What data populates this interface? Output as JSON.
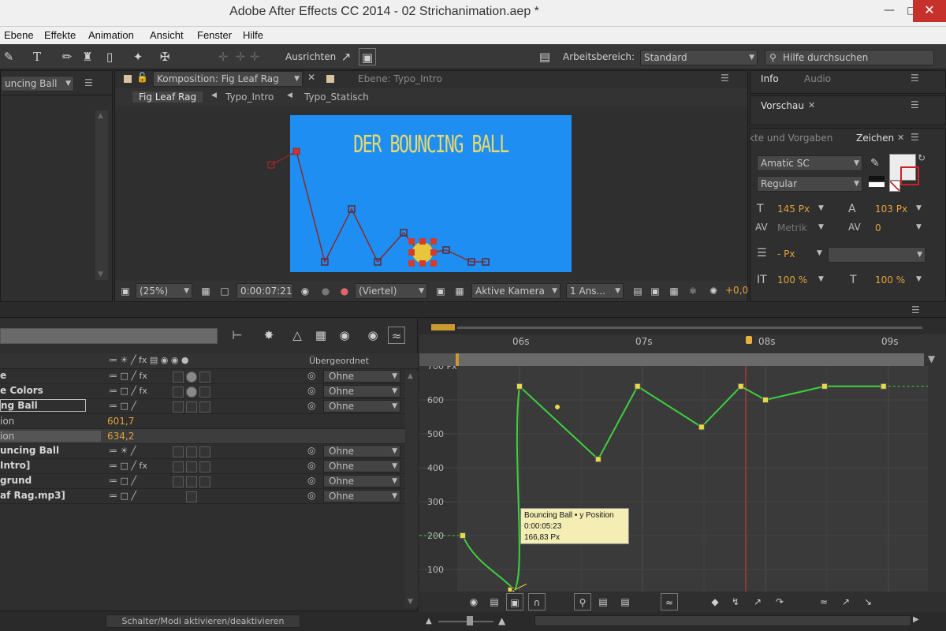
{
  "window": {
    "title": "Adobe After Effects CC 2014 - 02 Strichanimation.aep *"
  },
  "menu": [
    "Ebene",
    "Effekte",
    "Animation",
    "Ansicht",
    "Fenster",
    "Hilfe"
  ],
  "toolbar": {
    "ausrichten_label": "Ausrichten",
    "arbeitsbereich_label": "Arbeitsbereich:",
    "arbeitsbereich_value": "Standard",
    "search_placeholder": "Hilfe durchsuchen"
  },
  "project_panel": {
    "dropdown": "uncing Ball"
  },
  "comp_panel": {
    "tab_label": "Komposition: Fig Leaf Rag",
    "layer_tab": "Ebene: Typo_Intro",
    "breadcrumbs": [
      "Fig Leaf Rag",
      "Typo_Intro",
      "Typo_Statisch"
    ],
    "canvas_text": "DER BOUNCING BALL",
    "zoom": "(25%)",
    "timecode": "0:00:07:21",
    "resolution": "(Viertel)",
    "camera": "Aktive Kamera",
    "views": "1 Ans...",
    "exposure": "+0,0"
  },
  "right_panel": {
    "tabs_top": [
      "Info",
      "Audio"
    ],
    "vorschau": "Vorschau",
    "effects_tab": "kte und Vorgaben",
    "zeichen_tab": "Zeichen",
    "font": "Amatic SC",
    "style": "Regular",
    "size": "145 Px",
    "leading": "103 Px",
    "kerning": "Metrik",
    "tracking": "0",
    "stroke": "- Px",
    "vscale": "100 %",
    "hscale": "100 %",
    "colors": {
      "fill": "#ececec",
      "stroke_none": "#cc2222"
    }
  },
  "timeline": {
    "parent_header": "Übergeordnet",
    "layers": [
      {
        "name": "e",
        "parent": "Ohne"
      },
      {
        "name": "e Colors",
        "parent": "Ohne"
      },
      {
        "name": "ng Ball",
        "parent": "Ohne"
      },
      {
        "name": "ion",
        "value": "601,7"
      },
      {
        "name": "ion",
        "value": "634,2"
      },
      {
        "name": "uncing Ball",
        "parent": "Ohne"
      },
      {
        "name": "Intro]",
        "parent": "Ohne"
      },
      {
        "name": "grund",
        "parent": "Ohne"
      },
      {
        "name": "af Rag.mp3]",
        "parent": "Ohne"
      }
    ],
    "footer_toggle": "Schalter/Modi aktivieren/deaktivieren",
    "ruler": [
      "06s",
      "07s",
      "08s",
      "09s"
    ],
    "y_axis": [
      "700 Px",
      "600",
      "500",
      "400",
      "300",
      "200",
      "100"
    ]
  },
  "tooltip": {
    "line1": "Bouncing Ball • y Position",
    "line2": "0:00:05:23",
    "line3": "166,83 Px"
  },
  "chart_data": {
    "type": "line",
    "series": [
      {
        "name": "Bouncing Ball • y Position"
      }
    ],
    "x": [
      "05:24",
      "06:00",
      "06:16",
      "06:24",
      "07:12",
      "07:20",
      "08:00",
      "08:12",
      "08:24"
    ],
    "values": [
      166.8,
      640,
      425,
      640,
      520,
      640,
      600,
      640,
      640
    ],
    "ylim": [
      80,
      700
    ]
  }
}
